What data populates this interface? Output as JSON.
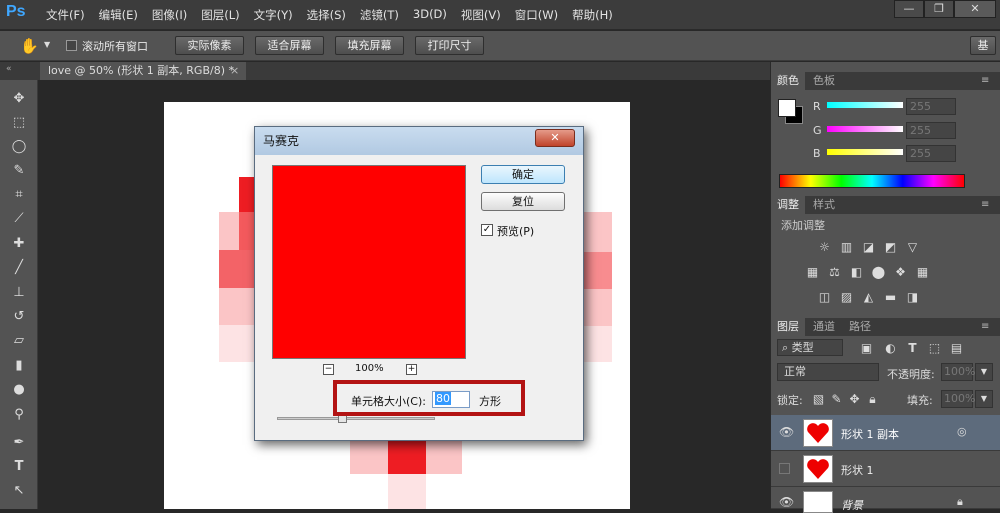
{
  "app": {
    "logo": "Ps",
    "menu": [
      "文件(F)",
      "编辑(E)",
      "图像(I)",
      "图层(L)",
      "文字(Y)",
      "选择(S)",
      "滤镜(T)",
      "3D(D)",
      "视图(V)",
      "窗口(W)",
      "帮助(H)"
    ],
    "window_controls": {
      "minimize": "—",
      "restore": "❐",
      "close": "✕"
    }
  },
  "options_bar": {
    "scroll_all": "滚动所有窗口",
    "buttons": [
      "实际像素",
      "适合屏幕",
      "填充屏幕",
      "打印尺寸"
    ],
    "workspace": "基"
  },
  "document_tab": {
    "label": "love @ 50% (形状 1 副本, RGB/8) *",
    "close": "×"
  },
  "mosaic_dialog": {
    "title": "马赛克",
    "close_label": "✕",
    "ok_label": "确定",
    "reset_label": "复位",
    "preview_label": "预览(P)",
    "preview_checked": true,
    "zoom_percent": "100%",
    "zoom_minus": "−",
    "zoom_plus": "+",
    "cell_size_label": "单元格大小(C):",
    "cell_size_value": "80",
    "cell_size_unit": "方形",
    "preview_color": "#ff0000"
  },
  "color_panel": {
    "tabs": [
      "颜色",
      "色板"
    ],
    "channels": [
      {
        "label": "R",
        "value": "255"
      },
      {
        "label": "G",
        "value": "255"
      },
      {
        "label": "B",
        "value": "255"
      }
    ]
  },
  "adjustments_panel": {
    "tabs": [
      "调整",
      "样式"
    ],
    "title": "添加调整"
  },
  "layers_panel": {
    "tabs": [
      "图层",
      "通道",
      "路径"
    ],
    "filter_label": "类型",
    "blend_mode": "正常",
    "opacity_label": "不透明度:",
    "opacity_value": "100%",
    "lock_label": "锁定:",
    "fill_label": "填充:",
    "fill_value": "100%",
    "layers": [
      {
        "name": "形状 1 副本",
        "visible": true,
        "selected": true
      },
      {
        "name": "形状 1",
        "visible": false,
        "selected": false
      },
      {
        "name": "背景",
        "visible": true,
        "selected": false
      }
    ]
  }
}
